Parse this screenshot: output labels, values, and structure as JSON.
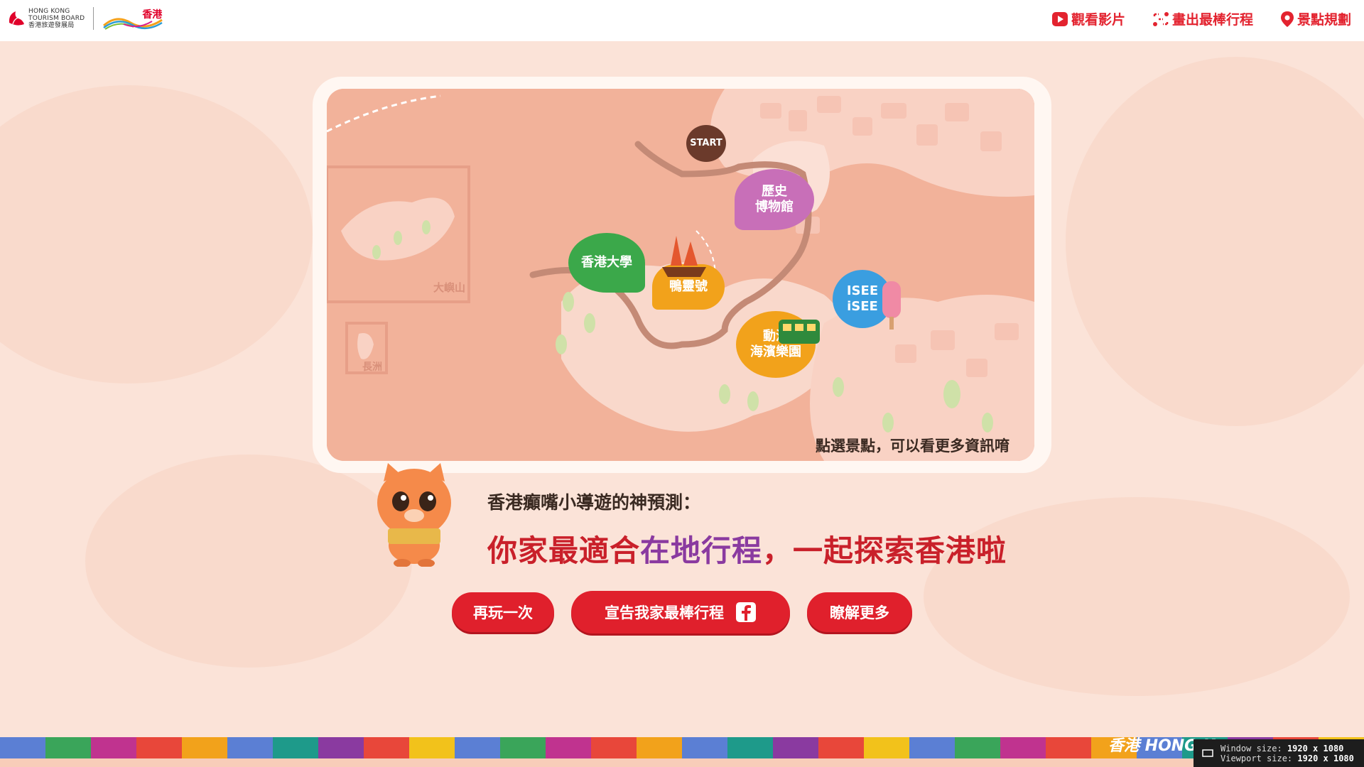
{
  "header": {
    "hktb_line1": "HONG KONG",
    "hktb_line2": "TOURISM BOARD",
    "hktb_chinese": "香港旅遊發展局",
    "brand_chinese": "香港",
    "nav": [
      {
        "label": "觀看影片",
        "icon": "play-icon"
      },
      {
        "label": "畫出最棒行程",
        "icon": "route-icon"
      },
      {
        "label": "景點規劃",
        "icon": "location-pin-icon"
      }
    ]
  },
  "map": {
    "start_label": "START",
    "spots": [
      {
        "label_line1": "歷史",
        "label_line2": "博物館",
        "color": "#c86fb8"
      },
      {
        "label_line1": "香港大學",
        "label_line2": "",
        "color": "#3ba84a"
      },
      {
        "label_line1": "鴨靈號",
        "label_line2": "",
        "color": "#f2a21b"
      },
      {
        "label_line1": "ISEE",
        "label_line2": "iSEE",
        "color": "#3a9ee0"
      },
      {
        "label_line1": "動漫",
        "label_line2": "海濱樂園",
        "color": "#f2a21b"
      }
    ],
    "area_labels": [
      "大嶼山",
      "長洲"
    ],
    "hint": "點選景點，可以看更多資訊唷"
  },
  "slogan": {
    "sub": "香港癲嘴小導遊的神預測：",
    "headline_pre": "你家最適合",
    "headline_highlight": "在地行程",
    "headline_post": "，一起探索香港啦"
  },
  "buttons": {
    "replay": "再玩一次",
    "share": "宣告我家最棒行程",
    "more": "瞭解更多"
  },
  "footer": {
    "brand": "香港 HONG K",
    "window_size_label": "Window size:",
    "window_size_value": "1920 x 1080",
    "viewport_size_label": "Viewport size:",
    "viewport_size_value": "1920 x 1080"
  },
  "colors": {
    "accent_red": "#e0202c",
    "background": "#fbe3d8",
    "map_base": "#f2b29a"
  }
}
